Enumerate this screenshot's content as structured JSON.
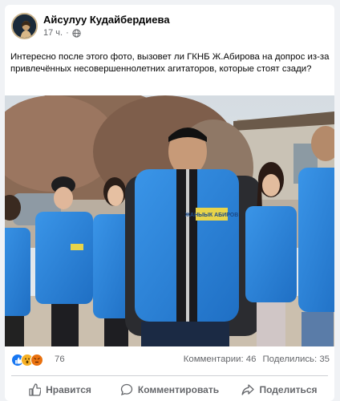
{
  "post": {
    "author": "Айсулуу Кудайбердиева",
    "time": "17 ч.",
    "separator": "·",
    "text": "Интересно после этого фото, вызовет ли ГКНБ Ж.Абирова на допрос из-за привлечённых несовершеннолетних агитаторов, которые стоят сзади?",
    "photo_vest_text": "ЖАНЫЫК АБИРОВ"
  },
  "stats": {
    "reaction_count": "76",
    "comments": "Комментарии: 46",
    "shares": "Поделились: 35"
  },
  "actions": {
    "like": "Нравится",
    "comment": "Комментировать",
    "share": "Поделиться"
  },
  "colors": {
    "accent": "#1877f2",
    "vest_blue": "#2a7fd6",
    "text_secondary": "#65676b"
  },
  "icons": [
    "avatar-image",
    "globe-icon",
    "like-reaction-icon",
    "wow-reaction-icon",
    "angry-reaction-icon",
    "thumbs-up-icon",
    "comment-icon",
    "share-icon"
  ]
}
